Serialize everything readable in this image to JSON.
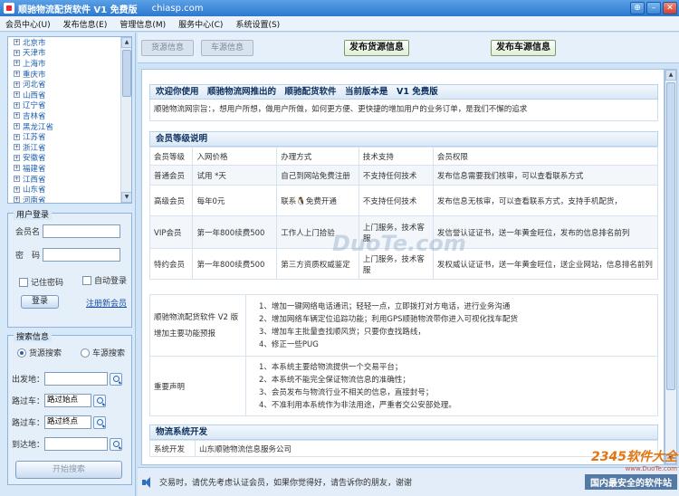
{
  "window": {
    "title": "顺驰物流配货软件 V1 免费版",
    "domain": "chiasp.com",
    "controls": [
      "⊕",
      "–",
      "✕"
    ]
  },
  "menu": [
    "会员中心(U)",
    "发布信息(E)",
    "管理信息(M)",
    "服务中心(C)",
    "系统设置(S)"
  ],
  "provinces": [
    "北京市",
    "天津市",
    "上海市",
    "重庆市",
    "河北省",
    "山西省",
    "辽宁省",
    "吉林省",
    "黑龙江省",
    "江苏省",
    "浙江省",
    "安徽省",
    "福建省",
    "江西省",
    "山东省",
    "河南省",
    "湖北省"
  ],
  "login": {
    "legend": "用户登录",
    "username_label": "会员名",
    "password_label": "密　码",
    "remember": "记住密码",
    "auto_login": "自动登录",
    "login_btn": "登录",
    "register": "注册新会员"
  },
  "search": {
    "legend": "搜索信息",
    "opt_goods": "货源搜索",
    "opt_vehicle": "车源搜索",
    "from_label": "出发地：",
    "route1_label": "路过车：",
    "route1_value": "路过始点",
    "route2_label": "路过车：",
    "route2_value": "路过终点",
    "to_label": "到达地：",
    "start_btn": "开始搜索"
  },
  "toolbar": {
    "goods_info": "货源信息",
    "vehicle_info": "车源信息",
    "publish_goods": "发布货源信息",
    "publish_vehicle": "发布车源信息"
  },
  "welcome": {
    "title": "欢迎你使用　顺驰物流网推出的　顺驰配货软件　当前版本是　V1 免费版",
    "purpose": "顺驰物流网宗旨：，想用户所想，做用户所做，如何更方便、更快捷的增加用户的业务订单，是我们不懈的追求"
  },
  "levels": {
    "title": "会员等级说明",
    "headers": [
      "会员等级",
      "入网价格",
      "办理方式",
      "技术支持",
      "会员权限"
    ],
    "rows": [
      [
        "普通会员",
        "试用 *天",
        "自己到网站免费注册",
        "不支持任何技术",
        "发布信息需要我们核审，可以查看联系方式"
      ],
      [
        "高级会员",
        "每年0元",
        "联系🐧免费开通",
        "不支持任何技术",
        "发布信息无核审，可以查看联系方式，支持手机配货，"
      ],
      [
        "VIP会员",
        "第一年800续费500",
        "工作人上门拾验",
        "上门服务，技术客服",
        "发信誉认证证书，送一年黄金旺位，发布的信息排名前列"
      ],
      [
        "特约会员",
        "第一年800续费500",
        "第三方资质权威鉴定",
        "上门服务，技术客服",
        "发权威认证证书，送一年黄金旺位，送企业网站，信息排名前列"
      ]
    ]
  },
  "version": {
    "label1": "顺驰物流配货软件 V2 版",
    "label2": "增加主要功能预报",
    "items": [
      "1、增加一键网络电话通讯；轻轻一点，立即拨打对方电话，进行业务沟通",
      "2、增加网络车辆定位追踪功能；利用GPS顺驰物流带你进入可视化找车配货",
      "3、增加车主批量查找顺风货；只要你查找路线，",
      "4、修正一些PUG"
    ]
  },
  "statement": {
    "label": "重要声明",
    "items": [
      "1、本系统主要给物流提供一个交易平台；",
      "2、本系统不能完全保证物流信息的准确性；",
      "3、会员发布与物流行业不相关的信息，直接封号；",
      "4、不准利用本系统作为非法用途，严重者交公安部处理。"
    ]
  },
  "dev": {
    "title": "物流系统开发",
    "label": "系统开发",
    "value": "山东顺驰物流信息服务公司"
  },
  "status": {
    "text": "交易时，请优先考虑认证会员，如果你觉得好，请告诉你的朋友，谢谢"
  },
  "watermark": {
    "center": "DuoTe.com",
    "brand": "2345软件大全",
    "url": "www.DuoTe.com",
    "sub": "国内最安全的软件站"
  }
}
